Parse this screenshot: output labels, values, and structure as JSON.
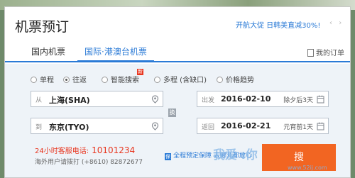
{
  "header": {
    "title": "机票预订",
    "promo_text": "开航大促 日韩美直减30%!",
    "promo_hot": "|",
    "prev_arrow": "‹",
    "next_arrow": "›"
  },
  "tabs": [
    {
      "label": "国内机票"
    },
    {
      "label": "国际·港澳台机票"
    }
  ],
  "orders_label": "我的订单",
  "trip_types": [
    {
      "label": "单程",
      "selected": false
    },
    {
      "label": "往返",
      "selected": true
    },
    {
      "label": "智能搜索",
      "selected": false,
      "badge": "新"
    },
    {
      "label": "多程 (含缺口)",
      "selected": false
    },
    {
      "label": "价格趋势",
      "selected": false
    }
  ],
  "from_field": {
    "label": "从",
    "value": "上海(SHA)"
  },
  "to_field": {
    "label": "到",
    "value": "东京(TYO)"
  },
  "swap_label": "换",
  "depart_field": {
    "label": "出发",
    "value": "2016-02-10",
    "note": "除夕后3天"
  },
  "return_field": {
    "label": "返回",
    "value": "2016-02-21",
    "note": "元宵前1天"
  },
  "hotline": {
    "label": "24小时客服电话:",
    "number": "10101234"
  },
  "intl_hotline": "海外用户请拨打 (+8610) 82872677",
  "guarantee": {
    "icon_text": "保",
    "text": "全程预定保障 去哪儿都放心"
  },
  "search_button": "搜",
  "watermark": {
    "main": "我爱  ı你",
    "sub": "www.52ij.com"
  },
  "colors": {
    "accent": "#2a7ad6",
    "hot": "#e8361f",
    "button": "#f26522"
  }
}
